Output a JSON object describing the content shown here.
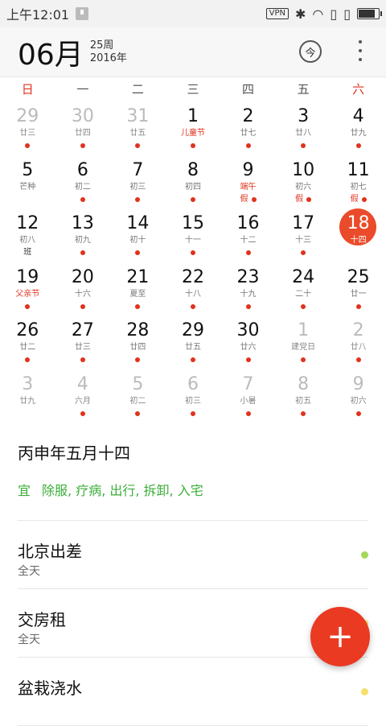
{
  "status": {
    "time": "上午12:01",
    "vpn": "VPN",
    "battery_level": 0.75
  },
  "header": {
    "month": "06月",
    "week": "25周",
    "year": "2016年",
    "today_icon": "今"
  },
  "weekdays": [
    "日",
    "一",
    "二",
    "三",
    "四",
    "五",
    "六"
  ],
  "calendar": {
    "weeks": [
      [
        {
          "day": "29",
          "lunar": "廿三",
          "dim": true,
          "dot": true
        },
        {
          "day": "30",
          "lunar": "廿四",
          "dim": true,
          "dot": true
        },
        {
          "day": "31",
          "lunar": "廿五",
          "dim": true,
          "dot": true
        },
        {
          "day": "1",
          "lunar": "儿童节",
          "lunar_red": true,
          "dot": true
        },
        {
          "day": "2",
          "lunar": "廿七",
          "dot": true
        },
        {
          "day": "3",
          "lunar": "廿八",
          "dot": true
        },
        {
          "day": "4",
          "lunar": "廿九",
          "dot": true
        }
      ],
      [
        {
          "day": "5",
          "lunar": "芒种"
        },
        {
          "day": "6",
          "lunar": "初二",
          "dot": true
        },
        {
          "day": "7",
          "lunar": "初三",
          "dot": true
        },
        {
          "day": "8",
          "lunar": "初四",
          "dot": true
        },
        {
          "day": "9",
          "lunar": "端午",
          "lunar_red": true,
          "badge": "假",
          "badge_red": true,
          "dot": true
        },
        {
          "day": "10",
          "lunar": "初六",
          "badge": "假",
          "badge_red": true,
          "dot": true
        },
        {
          "day": "11",
          "lunar": "初七",
          "badge": "假",
          "badge_red": true,
          "dot": true
        }
      ],
      [
        {
          "day": "12",
          "lunar": "初八",
          "badge": "班",
          "badge_dark": true
        },
        {
          "day": "13",
          "lunar": "初九",
          "dot": true
        },
        {
          "day": "14",
          "lunar": "初十",
          "dot": true
        },
        {
          "day": "15",
          "lunar": "十一",
          "dot": true
        },
        {
          "day": "16",
          "lunar": "十二",
          "dot": true
        },
        {
          "day": "17",
          "lunar": "十三",
          "dot": true
        },
        {
          "day": "18",
          "lunar": "十四",
          "selected": true,
          "dot": true
        }
      ],
      [
        {
          "day": "19",
          "lunar": "父亲节",
          "lunar_red": true,
          "dot": true
        },
        {
          "day": "20",
          "lunar": "十六",
          "dot": true
        },
        {
          "day": "21",
          "lunar": "夏至",
          "dot": true
        },
        {
          "day": "22",
          "lunar": "十八",
          "dot": true
        },
        {
          "day": "23",
          "lunar": "十九",
          "dot": true
        },
        {
          "day": "24",
          "lunar": "二十",
          "dot": true
        },
        {
          "day": "25",
          "lunar": "廿一",
          "dot": true
        }
      ],
      [
        {
          "day": "26",
          "lunar": "廿二",
          "dot": true
        },
        {
          "day": "27",
          "lunar": "廿三",
          "dot": true
        },
        {
          "day": "28",
          "lunar": "廿四",
          "dot": true
        },
        {
          "day": "29",
          "lunar": "廿五",
          "dot": true
        },
        {
          "day": "30",
          "lunar": "廿六",
          "dot": true
        },
        {
          "day": "1",
          "lunar": "建党日",
          "dim": true,
          "dot": true
        },
        {
          "day": "2",
          "lunar": "廿八",
          "dim": true,
          "dot": true
        }
      ],
      [
        {
          "day": "3",
          "lunar": "廿九",
          "dim": true
        },
        {
          "day": "4",
          "lunar": "六月",
          "dim": true,
          "dot": true
        },
        {
          "day": "5",
          "lunar": "初二",
          "dim": true,
          "dot": true
        },
        {
          "day": "6",
          "lunar": "初三",
          "dim": true,
          "dot": true
        },
        {
          "day": "7",
          "lunar": "小暑",
          "dim": true,
          "dot": true
        },
        {
          "day": "8",
          "lunar": "初五",
          "dim": true,
          "dot": true
        },
        {
          "day": "9",
          "lunar": "初六",
          "dim": true,
          "dot": true
        }
      ]
    ]
  },
  "lunar_info": {
    "title": "丙申年五月十四",
    "yi_label": "宜",
    "yi_items": "除服, 疗病, 出行, 拆卸, 入宅"
  },
  "events": [
    {
      "title": "北京出差",
      "sub": "全天",
      "color": "#a5d85a"
    },
    {
      "title": "交房租",
      "sub": "全天",
      "color": "#f5e06a"
    },
    {
      "title": "盆栽浇水",
      "sub": "",
      "color": "#f5e06a"
    }
  ],
  "fab": {
    "label": "+"
  },
  "colors": {
    "accent": "#ea4b2b",
    "green": "#3cae3a"
  }
}
